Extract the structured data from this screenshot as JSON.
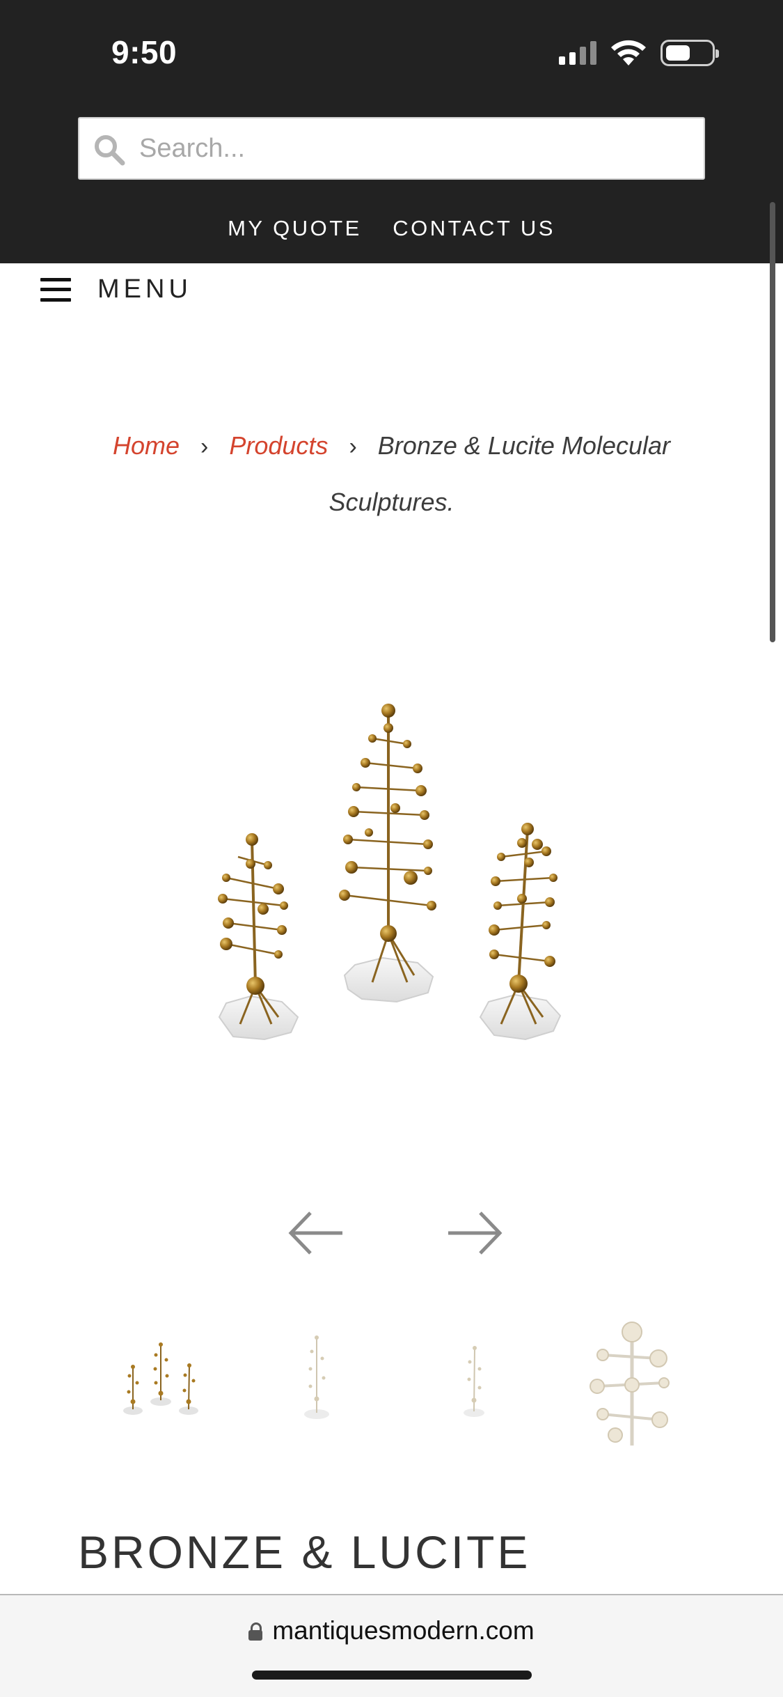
{
  "status_bar": {
    "time": "9:50",
    "icons": [
      "cellular-signal-icon",
      "wifi-icon",
      "battery-icon"
    ]
  },
  "header": {
    "search_placeholder": "Search...",
    "links": [
      "MY QUOTE",
      "CONTACT US"
    ],
    "background_color": "#222222"
  },
  "nav": {
    "menu_label": "MENU"
  },
  "breadcrumb": {
    "home": "Home",
    "products": "Products",
    "current": "Bronze & Lucite Molecular Sculptures."
  },
  "product": {
    "title": "BRONZE & LUCITE",
    "image_alt": "three bronze molecular sculptures on lucite bases",
    "thumbnails": [
      "thumbnail-trio",
      "thumbnail-single-sculpture",
      "thumbnail-small-sculpture",
      "thumbnail-detail"
    ]
  },
  "browser": {
    "url": "mantiquesmodern.com"
  },
  "colors": {
    "accent": "#d4442e",
    "text": "#333333",
    "header": "#222222"
  }
}
